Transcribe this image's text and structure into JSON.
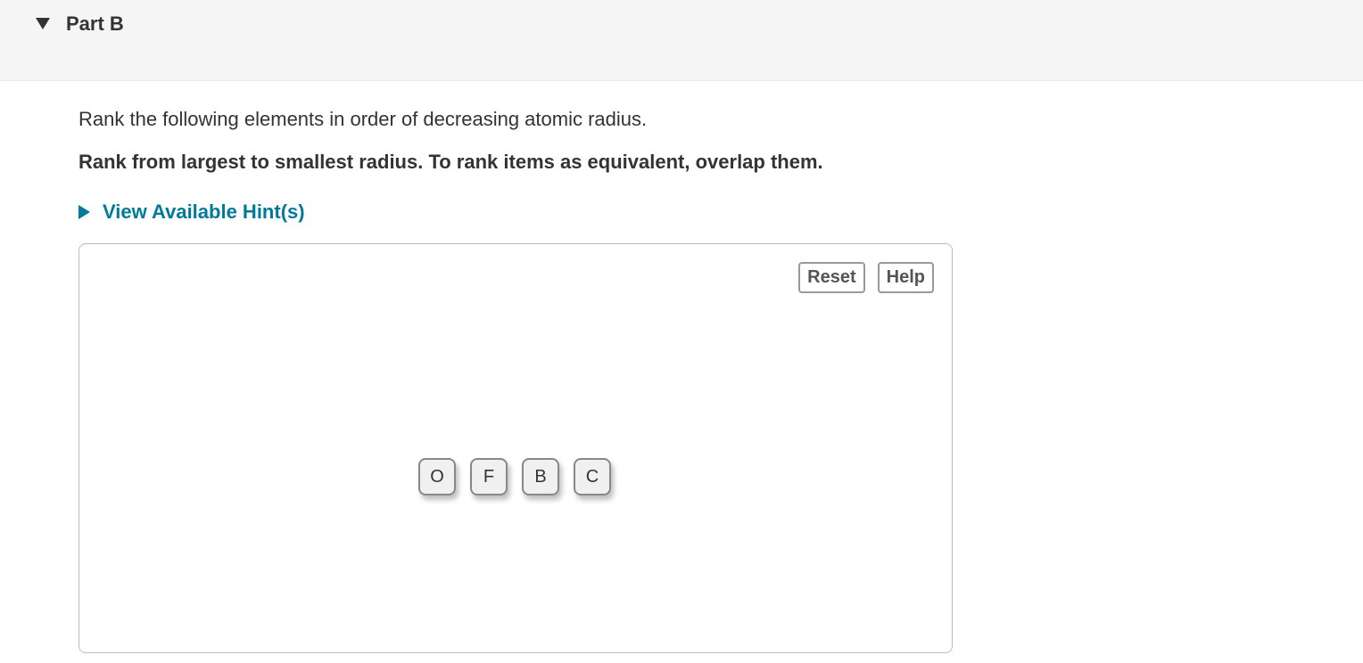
{
  "part": {
    "title": "Part B"
  },
  "question": {
    "prompt": "Rank the following elements in order of decreasing atomic radius.",
    "instruction": "Rank from largest to smallest radius. To rank items as equivalent, overlap them."
  },
  "hints": {
    "toggle_label": "View Available Hint(s)"
  },
  "controls": {
    "reset": "Reset",
    "help": "Help"
  },
  "tiles": {
    "items": [
      "O",
      "F",
      "B",
      "C"
    ]
  }
}
